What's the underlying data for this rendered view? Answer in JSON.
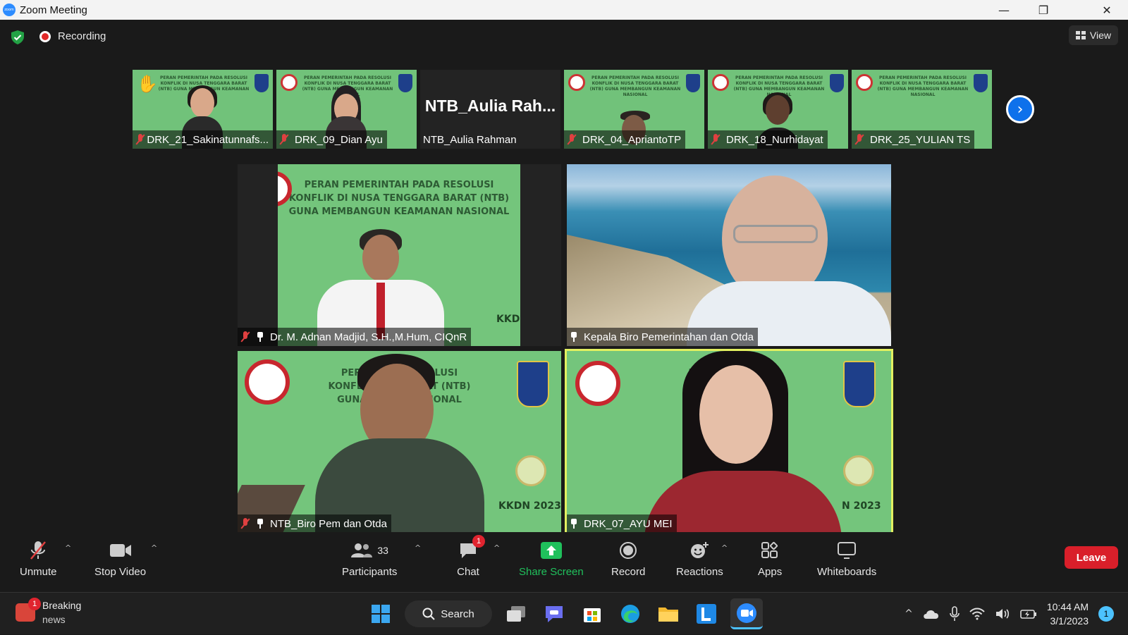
{
  "window": {
    "title": "Zoom Meeting",
    "minimize_glyph": "—",
    "restore_glyph": "❐",
    "close_glyph": "✕"
  },
  "header": {
    "recording_label": "Recording",
    "view_label": "View",
    "security_color": "#23a245"
  },
  "thumbnails": [
    {
      "name": "DRK_21_Sakinatunnafs...",
      "muted": true,
      "raised_hand": true
    },
    {
      "name": "DRK_09_Dian Ayu",
      "muted": true
    },
    {
      "name": "NTB_Aulia Rahman",
      "display_name": "NTB_Aulia  Rah...",
      "video_off": true
    },
    {
      "name": "DRK_04_ApriantoTP",
      "muted": true
    },
    {
      "name": "DRK_18_Nurhidayat",
      "muted": true
    },
    {
      "name": "DRK_25_YULIAN TS",
      "muted": true
    }
  ],
  "thumb_slide_text": "PERAN PEMERINTAH PADA RESOLUSI KONFLIK DI NUSA TENGGARA BARAT (NTB) GUNA MEMBANGUN KEAMANAN NASIONAL",
  "next_page_glyph": "›",
  "main_tiles": [
    {
      "name": "Dr. M. Adnan Madjid, S.H.,M.Hum, CIQnR",
      "slide_title_1": "PERAN PEMERINTAH PADA RESOLUSI",
      "slide_title_2": "KONFLIK DI NUSA TENGGARA BARAT (NTB)",
      "slide_title_3": "GUNA MEMBANGUN KEAMANAN NASIONAL",
      "slide_event": "KKDI",
      "muted": true,
      "pinned": true
    },
    {
      "name": "Kepala Biro Pemerintahan dan Otda",
      "pinned": true
    },
    {
      "name": "NTB_Biro Pem dan Otda",
      "slide_title_1": "PERAN P          DA RESOLUSI",
      "slide_title_2": "KONFLIK D          RA BARAT (NTB)",
      "slide_title_3": "GUNA MEM          N NASIONAL",
      "slide_event": "KKDN 2023",
      "muted": true,
      "pinned": true
    },
    {
      "name": "DRK_07_AYU MEI",
      "slide_title_1": "PERA                RESOLUSI",
      "slide_title_2": "KONF                (NTB)",
      "slide_title_3": "GUNA                NASIONAL",
      "slide_event": "N 2023",
      "pinned": true,
      "active_speaker": true
    }
  ],
  "toolbar": {
    "unmute_label": "Unmute",
    "stop_video_label": "Stop Video",
    "participants_label": "Participants",
    "participants_count": "33",
    "chat_label": "Chat",
    "chat_badge": "1",
    "share_label": "Share Screen",
    "record_label": "Record",
    "reactions_label": "Reactions",
    "apps_label": "Apps",
    "whiteboards_label": "Whiteboards",
    "leave_label": "Leave",
    "caret_glyph": "^",
    "share_color": "#20c05c",
    "leave_color": "#d91f2a"
  },
  "taskbar": {
    "news_title": "Breaking",
    "news_subtitle": "news",
    "news_badge": "1",
    "search_label": "Search",
    "time": "10:44 AM",
    "date": "3/1/2023",
    "notification_count": "1",
    "overflow_glyph": "^"
  }
}
